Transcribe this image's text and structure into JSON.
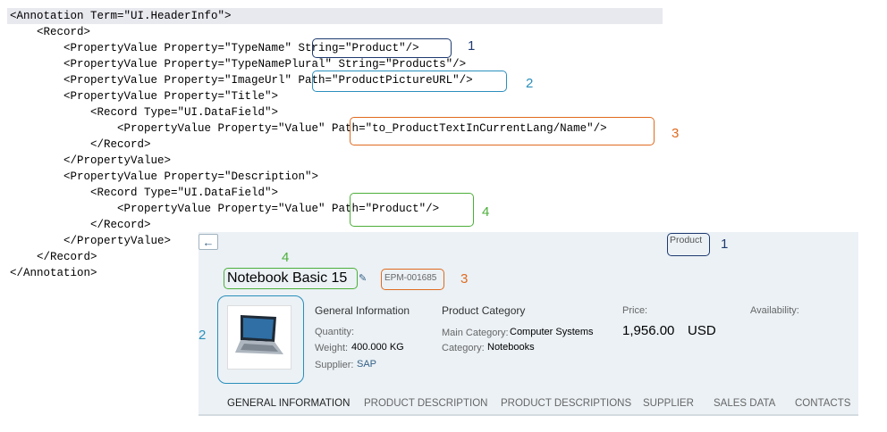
{
  "code": {
    "lines": [
      "<Annotation Term=\"UI.HeaderInfo\">",
      "    <Record>",
      "        <PropertyValue Property=\"TypeName\" String=\"Product\"/>",
      "        <PropertyValue Property=\"TypeNamePlural\" String=\"Products\"/>",
      "        <PropertyValue Property=\"ImageUrl\" Path=\"ProductPictureURL\"/>",
      "        <PropertyValue Property=\"Title\">",
      "            <Record Type=\"UI.DataField\">",
      "                <PropertyValue Property=\"Value\" Path=\"to_ProductTextInCurrentLang/Name\"/>",
      "            </Record>",
      "        </PropertyValue>",
      "        <PropertyValue Property=\"Description\">",
      "            <Record Type=\"UI.DataField\">",
      "                <PropertyValue Property=\"Value\" Path=\"Product\"/>",
      "            </Record>",
      "        </PropertyValue>",
      "    </Record>",
      "</Annotation>"
    ]
  },
  "callouts": {
    "n1": "1",
    "n2": "2",
    "n3": "3",
    "n4": "4"
  },
  "app": {
    "back_icon": "arrow-left-icon",
    "type_name": "Product",
    "title": "Notebook Basic 15",
    "product_id": "EPM-001685",
    "general_info": {
      "heading": "General Information",
      "quantity_label": "Quantity:",
      "weight_label": "Weight:",
      "weight_value": "400.000 KG",
      "supplier_label": "Supplier:",
      "supplier_value": "SAP"
    },
    "category": {
      "heading": "Product Category",
      "main_label": "Main Category:",
      "main_value": "Computer Systems",
      "cat_label": "Category:",
      "cat_value": "Notebooks"
    },
    "price": {
      "label": "Price:",
      "value": "1,956.00",
      "currency": "USD"
    },
    "availability_label": "Availability:",
    "tabs": [
      "GENERAL INFORMATION",
      "PRODUCT DESCRIPTION",
      "PRODUCT DESCRIPTIONS",
      "SUPPLIER",
      "SALES DATA",
      "CONTACTS"
    ]
  },
  "colors": {
    "navy": "#1f3a70",
    "blue": "#2a8fbd",
    "orange": "#e06a1f",
    "green": "#4caf3a",
    "link": "#346187"
  }
}
